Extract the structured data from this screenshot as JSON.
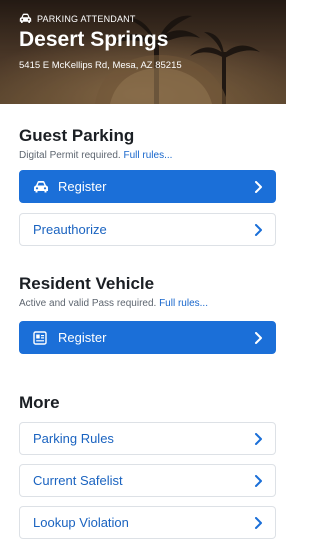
{
  "header": {
    "eyebrow": "Parking Attendant",
    "property_name": "Desert Springs",
    "address": "5415 E McKellips Rd, Mesa, AZ 85215"
  },
  "guest": {
    "title": "Guest Parking",
    "note": "Digital Permit required.",
    "rules_link": "Full rules...",
    "register_label": "Register",
    "preauthorize_label": "Preauthorize"
  },
  "resident": {
    "title": "Resident Vehicle",
    "note": "Active and valid Pass required.",
    "rules_link": "Full rules...",
    "register_label": "Register"
  },
  "more": {
    "title": "More",
    "parking_rules_label": "Parking Rules",
    "safelist_label": "Current Safelist",
    "lookup_label": "Lookup Violation"
  },
  "colors": {
    "primary": "#1b6fd8",
    "link": "#1766cc",
    "header_bg": "#3a2a1e"
  },
  "icons": {
    "eyebrow": "car-icon",
    "guest_register": "car-icon",
    "resident_register": "id-card-icon",
    "row_arrow": "chevron-right-icon"
  }
}
